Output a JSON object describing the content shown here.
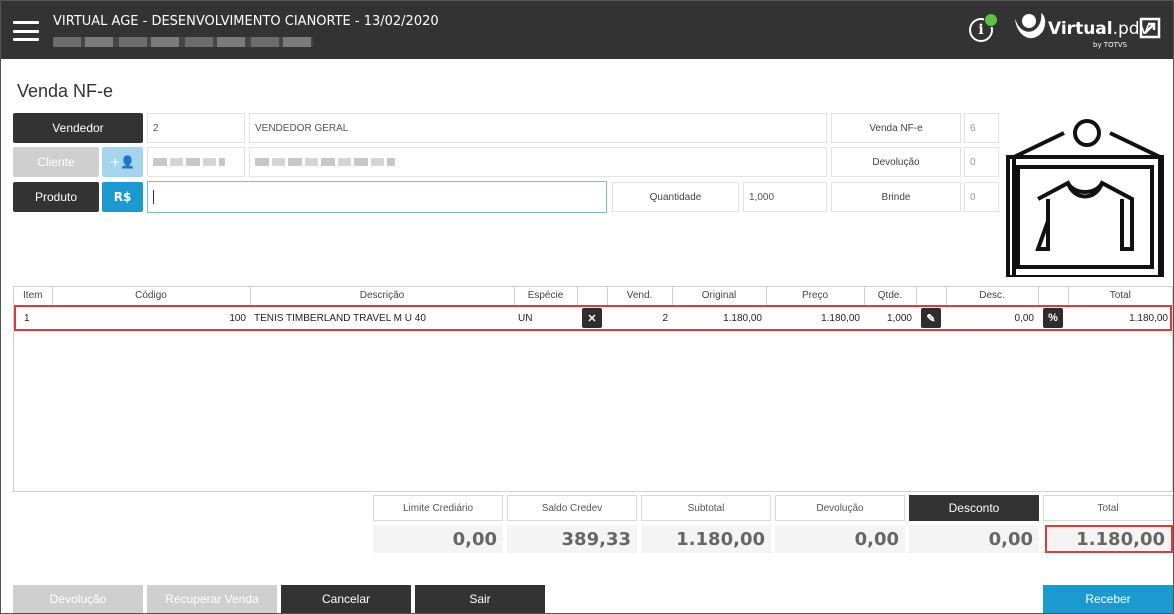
{
  "header": {
    "title": "VIRTUAL AGE - DESENVOLVIMENTO CIANORTE - 13/02/2020",
    "info_icon": "i",
    "logo_main": "Virtual",
    "logo_suffix": ".pdv",
    "logo_sub": "by TOTVS",
    "status_color": "#5dc144"
  },
  "page": {
    "title": "Venda NF-e"
  },
  "form": {
    "vendedor_label": "Vendedor",
    "vendedor_code": "2",
    "vendedor_name": "VENDEDOR GERAL",
    "cliente_label": "Cliente",
    "cliente_add_icon": "+👤",
    "produto_label": "Produto",
    "price_button": "R$",
    "produto_value": "",
    "quantidade_label": "Quantidade",
    "quantidade_value": "1,000",
    "venda_nfe_label": "Venda NF-e",
    "venda_nfe_value": "6",
    "devolucao_label": "Devolução",
    "devolucao_value": "0",
    "brinde_label": "Brinde",
    "brinde_value": "0"
  },
  "table": {
    "headers": [
      "Item",
      "Código",
      "Descrição",
      "Espécie",
      "",
      "Vend.",
      "Original",
      "Preço",
      "Qtde.",
      "",
      "Desc.",
      "",
      "Total"
    ],
    "rows": [
      {
        "item": "1",
        "codigo": "100",
        "descricao": "TENIS TIMBERLAND TRAVEL M U 40",
        "especie": "UN",
        "vend": "2",
        "original": "1.180,00",
        "preco": "1.180,00",
        "qtde": "1,000",
        "desc": "0,00",
        "total": "1.180,00"
      }
    ]
  },
  "totals": {
    "limite_label": "Limite Crediário",
    "limite_value": "0,00",
    "saldo_label": "Saldo Credev",
    "saldo_value": "389,33",
    "subtotal_label": "Subtotal",
    "subtotal_value": "1.180,00",
    "devolucao_label": "Devolução",
    "devolucao_value": "0,00",
    "desconto_label": "Desconto",
    "desconto_value": "0,00",
    "total_label": "Total",
    "total_value": "1.180,00"
  },
  "footer": {
    "devolucao": "Devolução",
    "recuperar": "Recuperar Venda",
    "cancelar": "Cancelar",
    "sair": "Sair",
    "receber": "Receber"
  },
  "colors": {
    "header_bg": "#333333",
    "accent_blue": "#1b9ad0",
    "highlight_red": "#e03a3a"
  }
}
